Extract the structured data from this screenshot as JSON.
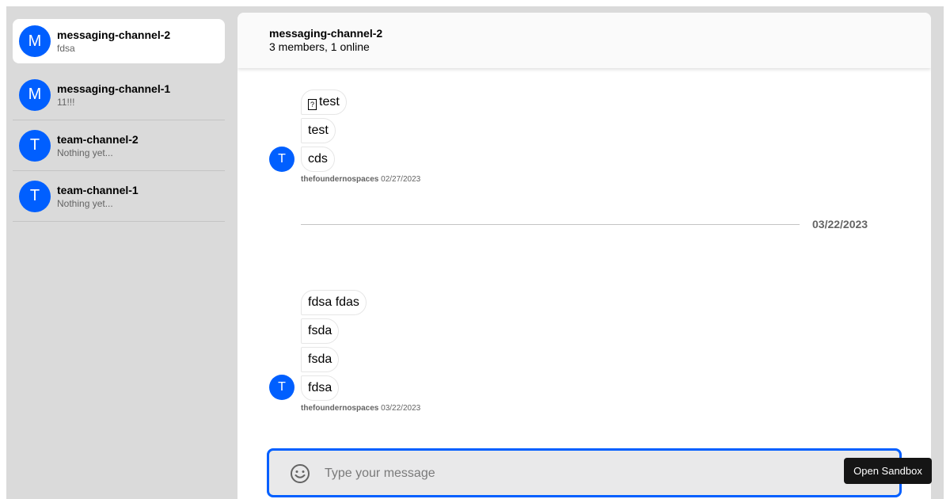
{
  "sidebar": {
    "channels": [
      {
        "avatar": "M",
        "name": "messaging-channel-2",
        "preview": "fdsa"
      },
      {
        "avatar": "M",
        "name": "messaging-channel-1",
        "preview": "11!!!"
      },
      {
        "avatar": "T",
        "name": "team-channel-2",
        "preview": "Nothing yet..."
      },
      {
        "avatar": "T",
        "name": "team-channel-1",
        "preview": "Nothing yet..."
      }
    ]
  },
  "header": {
    "title": "messaging-channel-2",
    "subtitle": "3 members, 1 online"
  },
  "messages": {
    "group1": {
      "avatar": "T",
      "bubbles": [
        "test",
        "test",
        "cds"
      ],
      "author": "thefoundernospaces",
      "date": "02/27/2023"
    },
    "divider_date": "03/22/2023",
    "group2": {
      "avatar": "T",
      "bubbles": [
        "fdsa fdas",
        "fsda",
        "fsda",
        "fdsa"
      ],
      "author": "thefoundernospaces",
      "date": "03/22/2023"
    }
  },
  "composer": {
    "placeholder": "Type your message",
    "emoji_icon": "smile-icon"
  },
  "sandbox_button": "Open Sandbox",
  "colors": {
    "accent": "#005fff",
    "sidebar_bg": "#dadada"
  }
}
